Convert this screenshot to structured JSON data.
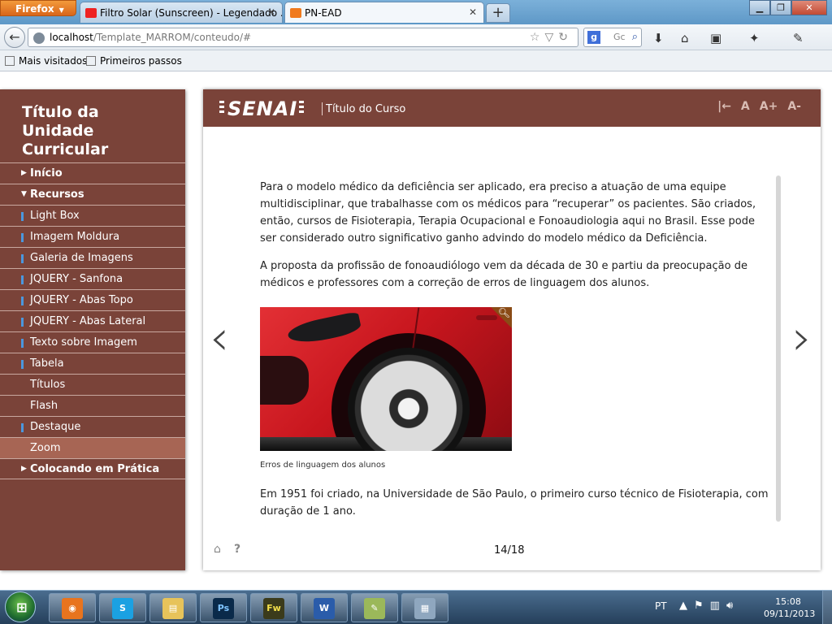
{
  "browser": {
    "menu_button": "Firefox",
    "tabs": [
      {
        "label": "Filtro Solar (Sunscreen) - Legendado ...",
        "active": false,
        "icon": "youtube-icon"
      },
      {
        "label": "PN-EAD",
        "active": true,
        "icon": "xampp-icon"
      }
    ],
    "url_host": "localhost",
    "url_path": "/Template_MARROM/conteudo/#",
    "search_placeholder": "Gc",
    "bookmarks": [
      "Mais visitados",
      "Primeiros passos"
    ]
  },
  "sidebar": {
    "title": "Título da Unidade Curricular",
    "items": [
      {
        "label": "Início",
        "style": "section-collapsed"
      },
      {
        "label": "Recursos",
        "style": "section-expanded"
      },
      {
        "label": "Light Box",
        "style": "marked"
      },
      {
        "label": "Imagem Moldura",
        "style": "marked"
      },
      {
        "label": "Galeria de Imagens",
        "style": "marked"
      },
      {
        "label": "JQUERY - Sanfona",
        "style": "marked"
      },
      {
        "label": "JQUERY - Abas Topo",
        "style": "marked"
      },
      {
        "label": "JQUERY - Abas Lateral",
        "style": "marked"
      },
      {
        "label": "Texto sobre Imagem",
        "style": "marked"
      },
      {
        "label": "Tabela",
        "style": "marked"
      },
      {
        "label": "Títulos",
        "style": "plain"
      },
      {
        "label": "Flash",
        "style": "plain"
      },
      {
        "label": "Destaque",
        "style": "marked"
      },
      {
        "label": "Zoom",
        "style": "active"
      },
      {
        "label": "Colocando em Prática",
        "style": "section-collapsed"
      }
    ]
  },
  "header": {
    "logo": "SENAI",
    "course_title": "Título do Curso",
    "tools": [
      "|←",
      "A",
      "A+",
      "A-"
    ]
  },
  "content": {
    "paragraphs": [
      "Para o modelo médico da deficiência ser aplicado, era preciso a atuação de uma equipe multidisciplinar, que trabalhasse com os médicos para “recuperar” os pacientes. São criados, então, cursos de Fisioterapia, Terapia Ocupacional e Fonoaudiologia aqui no Brasil. Esse pode ser considerado outro significativo ganho advindo do modelo médico da Deficiência.",
      "A proposta da profissão de fonoaudiólogo vem da década de 30 e partiu da preocupação de médicos e professores com a correção de erros de linguagem dos alunos."
    ],
    "image_caption": "Erros de linguagem dos alunos",
    "last_paragraph": "Em 1951 foi criado, na Universidade de São Paulo, o primeiro curso técnico de Fisioterapia, com duração de 1 ano.",
    "page_indicator": "14/18"
  },
  "taskbar": {
    "apps": [
      "firefox-icon",
      "skype-icon",
      "explorer-icon",
      "photoshop-icon",
      "fireworks-icon",
      "word-icon",
      "notepad-icon",
      "calculator-icon"
    ],
    "language": "PT",
    "time": "15:08",
    "date": "09/11/2013"
  },
  "colors": {
    "brand_brown": "#7a4339",
    "active_item": "#a76554",
    "marker_blue": "#4b97dd"
  }
}
